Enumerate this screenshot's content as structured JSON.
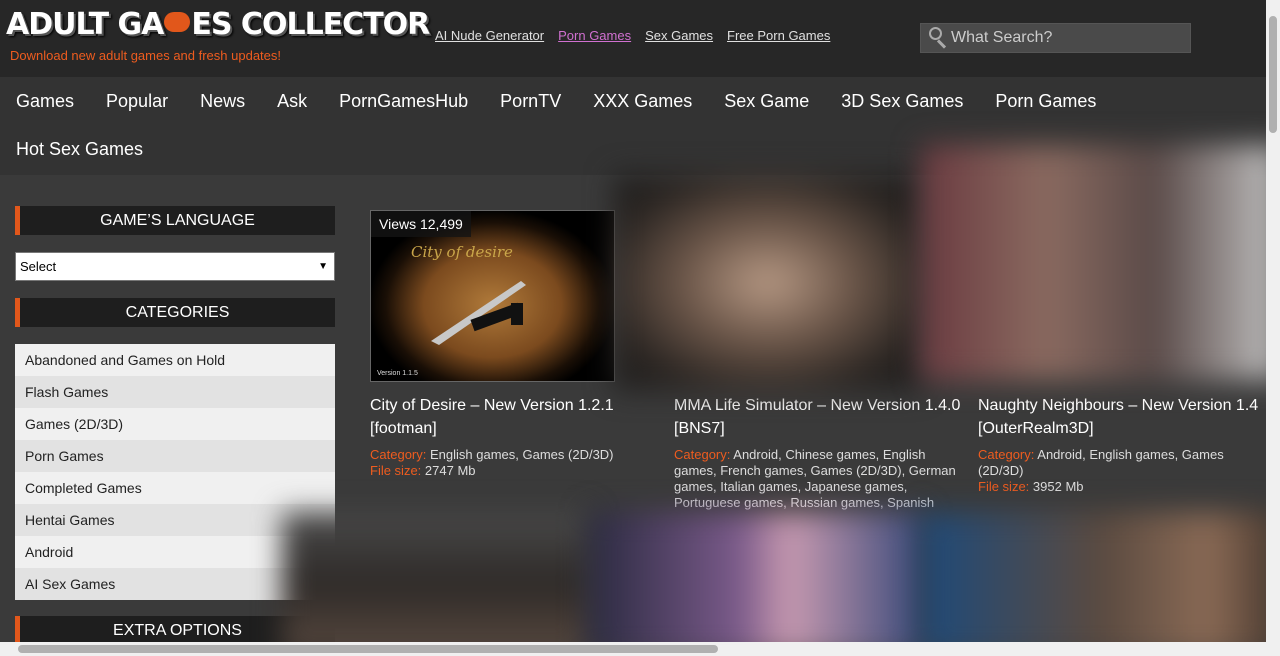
{
  "brand": {
    "logo_text": "ADULT GAMES COLLECTOR",
    "logo_pre": "ADULT GA",
    "logo_post": "ES COLLECTOR",
    "tagline": "Download new adult games and fresh updates!",
    "accent": "#e1571b"
  },
  "top_links": [
    "AI Nude Generator",
    "Porn Games",
    "Sex Games",
    "Free Porn Games"
  ],
  "search": {
    "placeholder": "What Search?"
  },
  "main_nav": [
    "Games",
    "Popular",
    "News",
    "Ask",
    "PornGamesHub",
    "PornTV",
    "XXX Games",
    "Sex Game",
    "3D Sex Games",
    "Porn Games",
    "Hot Sex Games"
  ],
  "sidebar": {
    "language_heading": "GAME’S LANGUAGE",
    "language_select": "Select",
    "categories_heading": "CATEGORIES",
    "categories": [
      "Abandoned and Games on Hold",
      "Flash Games",
      "Games (2D/3D)",
      "Porn Games",
      "Completed Games",
      "Hentai Games",
      "Android",
      "AI Sex Games"
    ],
    "extra_heading": "EXTRA OPTIONS"
  },
  "cards": [
    {
      "views": "Views 12,499",
      "thumb_text": "City of desire",
      "thumb_version": "Version 1.1.5",
      "title": "City of Desire – New Version 1.2.1 [footman]",
      "category_label": "Category:",
      "categories": "English games, Games (2D/3D)",
      "size_label": "File size:",
      "size": "2747 Mb"
    },
    {
      "title": "MMA Life Simulator – New Version 1.4.0 [BNS7]",
      "category_label": "Category:",
      "categories": "Android, Chinese games, English games, French games, Games (2D/3D), German games, Italian games, Japanese games, Portuguese games, Russian games, Spanish"
    },
    {
      "title": "Naughty Neighbours – New Version 1.4 [OuterRealm3D]",
      "category_label": "Category:",
      "categories": "Android, English games, Games (2D/3D)",
      "size_label": "File size:",
      "size": "3952 Mb"
    }
  ]
}
